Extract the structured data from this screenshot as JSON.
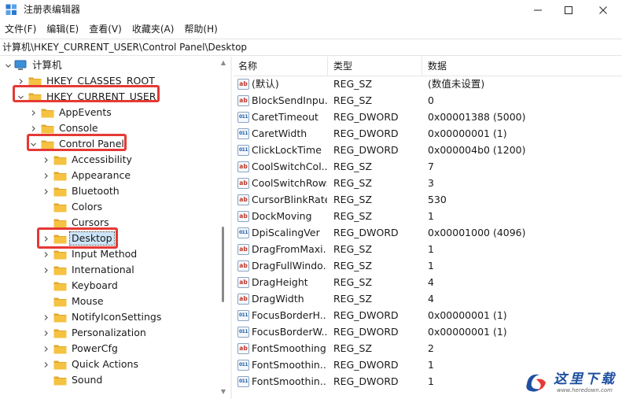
{
  "window": {
    "title": "注册表编辑器",
    "controls": {
      "minimize": "minimize-icon",
      "maximize": "maximize-icon",
      "close": "close-icon"
    }
  },
  "menu": [
    "文件(F)",
    "编辑(E)",
    "查看(V)",
    "收藏夹(A)",
    "帮助(H)"
  ],
  "address": "计算机\\HKEY_CURRENT_USER\\Control Panel\\Desktop",
  "tree": {
    "root": "计算机",
    "items": [
      {
        "label": "HKEY_CLASSES_ROOT",
        "depth": 1,
        "expanded": false
      },
      {
        "label": "HKEY_CURRENT_USER",
        "depth": 1,
        "expanded": true
      },
      {
        "label": "AppEvents",
        "depth": 2,
        "expanded": false
      },
      {
        "label": "Console",
        "depth": 2,
        "expanded": false
      },
      {
        "label": "Control Panel",
        "depth": 2,
        "expanded": true
      },
      {
        "label": "Accessibility",
        "depth": 3,
        "expanded": false
      },
      {
        "label": "Appearance",
        "depth": 3,
        "expanded": false
      },
      {
        "label": "Bluetooth",
        "depth": 3,
        "expanded": false
      },
      {
        "label": "Colors",
        "depth": 3,
        "expanded": null
      },
      {
        "label": "Cursors",
        "depth": 3,
        "expanded": null
      },
      {
        "label": "Desktop",
        "depth": 3,
        "expanded": false,
        "selected": true
      },
      {
        "label": "Input Method",
        "depth": 3,
        "expanded": false
      },
      {
        "label": "International",
        "depth": 3,
        "expanded": false
      },
      {
        "label": "Keyboard",
        "depth": 3,
        "expanded": null
      },
      {
        "label": "Mouse",
        "depth": 3,
        "expanded": null
      },
      {
        "label": "NotifyIconSettings",
        "depth": 3,
        "expanded": false
      },
      {
        "label": "Personalization",
        "depth": 3,
        "expanded": false
      },
      {
        "label": "PowerCfg",
        "depth": 3,
        "expanded": false
      },
      {
        "label": "Quick Actions",
        "depth": 3,
        "expanded": false
      },
      {
        "label": "Sound",
        "depth": 3,
        "expanded": null
      }
    ]
  },
  "values": {
    "headers": {
      "name": "名称",
      "type": "类型",
      "data": "数据"
    },
    "rows": [
      {
        "name": "(默认)",
        "type": "REG_SZ",
        "data": "(数值未设置)"
      },
      {
        "name": "BlockSendInpu...",
        "type": "REG_SZ",
        "data": "0"
      },
      {
        "name": "CaretTimeout",
        "type": "REG_DWORD",
        "data": "0x00001388 (5000)"
      },
      {
        "name": "CaretWidth",
        "type": "REG_DWORD",
        "data": "0x00000001 (1)"
      },
      {
        "name": "ClickLockTime",
        "type": "REG_DWORD",
        "data": "0x000004b0 (1200)"
      },
      {
        "name": "CoolSwitchCol...",
        "type": "REG_SZ",
        "data": "7"
      },
      {
        "name": "CoolSwitchRows",
        "type": "REG_SZ",
        "data": "3"
      },
      {
        "name": "CursorBlinkRate",
        "type": "REG_SZ",
        "data": "530"
      },
      {
        "name": "DockMoving",
        "type": "REG_SZ",
        "data": "1"
      },
      {
        "name": "DpiScalingVer",
        "type": "REG_DWORD",
        "data": "0x00001000 (4096)"
      },
      {
        "name": "DragFromMaxi...",
        "type": "REG_SZ",
        "data": "1"
      },
      {
        "name": "DragFullWindo...",
        "type": "REG_SZ",
        "data": "1"
      },
      {
        "name": "DragHeight",
        "type": "REG_SZ",
        "data": "4"
      },
      {
        "name": "DragWidth",
        "type": "REG_SZ",
        "data": "4"
      },
      {
        "name": "FocusBorderH...",
        "type": "REG_DWORD",
        "data": "0x00000001 (1)"
      },
      {
        "name": "FocusBorderW...",
        "type": "REG_DWORD",
        "data": "0x00000001 (1)"
      },
      {
        "name": "FontSmoothing",
        "type": "REG_SZ",
        "data": "2"
      },
      {
        "name": "FontSmoothin...",
        "type": "REG_DWORD",
        "data": "1"
      },
      {
        "name": "FontSmoothin...",
        "type": "REG_DWORD",
        "data": "1"
      }
    ]
  },
  "icons": {
    "string_value": "ab",
    "dword_value": "011"
  },
  "watermark": {
    "title": "这里下载",
    "url": "www.heredown.com"
  },
  "colors": {
    "highlight_box": "#e53935",
    "selection": "#cce4f7",
    "folder": "#f5c242",
    "folder_dark": "#e0a82e",
    "watermark_blue": "#1e4fa0"
  }
}
